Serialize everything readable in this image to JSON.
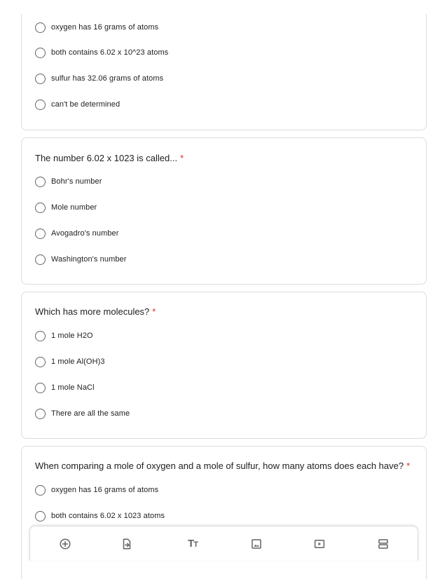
{
  "cards": [
    {
      "question": "",
      "required": false,
      "options": [
        "oxygen has 16 grams of atoms",
        "both contains 6.02 x 10^23 atoms",
        "sulfur has 32.06 grams of atoms",
        "can't be determined"
      ]
    },
    {
      "question": "The number 6.02 x 1023 is called...",
      "required": true,
      "options": [
        "Bohr's number",
        "Mole number",
        "Avogadro's number",
        "Washington's number"
      ]
    },
    {
      "question": "Which has more molecules?",
      "required": true,
      "options": [
        "1 mole H2O",
        "1 mole Al(OH)3",
        "1 mole NaCl",
        "There are all the same"
      ]
    },
    {
      "question": "When comparing a mole of oxygen and a mole of sulfur, how many atoms does each have?",
      "required": true,
      "options": [
        "oxygen has 16 grams of atoms",
        "both contains 6.02 x 1023 atoms"
      ]
    }
  ],
  "required_marker": "*",
  "toolbar": {
    "add_question": "add-circle-icon",
    "import_questions": "import-icon",
    "add_title": "title-text-icon",
    "add_image": "image-icon",
    "add_video": "video-icon",
    "add_section": "section-icon",
    "title_glyph_big": "T",
    "title_glyph_small": "T"
  },
  "colors": {
    "required": "#d93025",
    "border": "#dadce0",
    "icon": "#5f6368"
  }
}
